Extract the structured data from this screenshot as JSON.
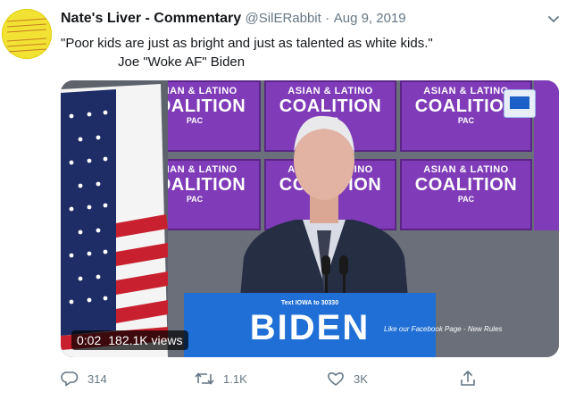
{
  "tweet": {
    "display_name": "Nate's Liver - Commentary",
    "handle": "@SilERabbit",
    "separator": "·",
    "date": "Aug 9, 2019",
    "text_line1": "\"Poor kids are just as bright and just as talented as white kids.\"",
    "text_line2": "Joe \"Woke AF\" Biden",
    "more_icon": "chevron-down-icon"
  },
  "video": {
    "duration": "0:02",
    "views": "182.1K views",
    "sign_small": "ASIAN & LATINO",
    "sign_big": "COALITION",
    "sign_pac": "PAC",
    "podium_text": "Text IOWA to 30330",
    "podium_name": "BIDEN",
    "caption": "Like our Facebook Page - New Rules"
  },
  "actions": {
    "reply_count": "314",
    "retweet_count": "1.1K",
    "like_count": "3K",
    "reply_icon": "reply-icon",
    "retweet_icon": "retweet-icon",
    "like_icon": "heart-icon",
    "share_icon": "share-icon"
  },
  "colors": {
    "text_primary": "#14171a",
    "text_secondary": "#657786",
    "sign_purple": "#7f3bb8",
    "podium_blue": "#1f6fd6"
  }
}
